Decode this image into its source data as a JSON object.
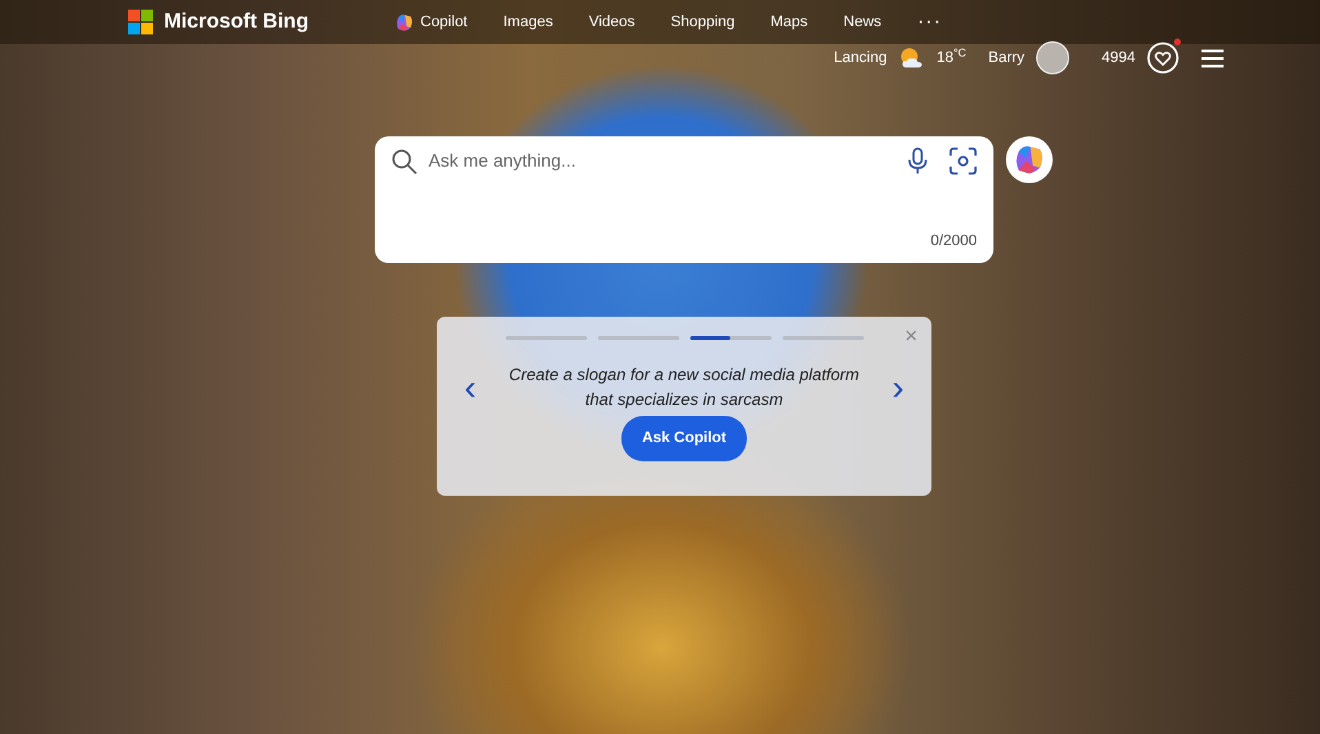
{
  "header": {
    "logo_text": "Microsoft Bing",
    "nav": [
      {
        "label": "Copilot",
        "kind": "copilot",
        "selected": false
      },
      {
        "label": "Images",
        "kind": "plain",
        "selected": false
      },
      {
        "label": "Videos",
        "kind": "plain",
        "selected": false
      },
      {
        "label": "Shopping",
        "kind": "plain",
        "selected": false
      },
      {
        "label": "Maps",
        "kind": "plain",
        "selected": false
      },
      {
        "label": "News",
        "kind": "plain",
        "selected": false
      },
      {
        "label": "···",
        "kind": "more",
        "selected": false
      }
    ],
    "location": "Lancing",
    "temperature": "18$^{°C}$",
    "user_name": "Barry",
    "points": "4994",
    "rewards_notification": true
  },
  "search": {
    "placeholder": "Ask me anything...",
    "counter": "0/2000"
  },
  "suggestion": {
    "steps": [
      {
        "level": 0
      },
      {
        "level": 0
      },
      {
        "level": 0.5
      },
      {
        "level": 0
      }
    ],
    "close": "×",
    "prev": "‹",
    "next": "›",
    "text": "Create a slogan for a new social media platform that specializes in sarcasm",
    "button": "Ask Copilot"
  }
}
